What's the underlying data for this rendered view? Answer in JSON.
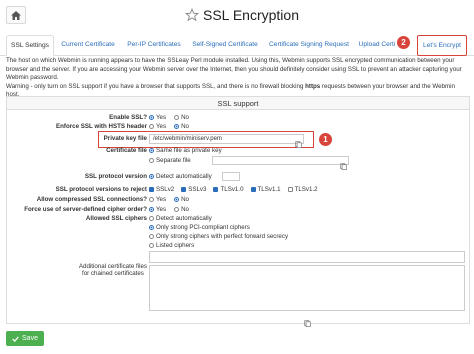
{
  "header": {
    "title": "SSL Encryption",
    "home_icon": "home-icon",
    "star_icon": "star-icon"
  },
  "tabs": [
    {
      "label": "SSL Settings",
      "active": true
    },
    {
      "label": "Current Certificate"
    },
    {
      "label": "Per-IP Certificates"
    },
    {
      "label": "Self-Signed Certificate"
    },
    {
      "label": "Certificate Signing Request"
    },
    {
      "label": "Upload Certi"
    },
    {
      "label": "Let's Encrypt",
      "highlighted": true
    }
  ],
  "annotations": {
    "badge1": "1",
    "badge2": "2",
    "accent": "#d9443a"
  },
  "intro": {
    "line1": "The host on which Webmin is running appears to have the SSLeay Perl module installed. Using this, Webmin supports SSL encrypted communication between your",
    "line2": "browser and the server. If you are accessing your Webmin server over the Internet, then you should definitely consider using SSL to prevent an attacker capturing your",
    "line3": "Webmin password.",
    "line4a": "Warning - only turn on SSL support if you have a browser that supports SSL, and there is no firewall blocking ",
    "line4b": "https",
    "line4c": " requests between your browser and the Webmin host."
  },
  "panel": {
    "title": "SSL support",
    "enable_ssl": {
      "label": "Enable SSL?",
      "yes": "Yes",
      "no": "No"
    },
    "hsts": {
      "label": "Enforce SSL with HSTS header",
      "yes": "Yes",
      "no": "No"
    },
    "private_key": {
      "label": "Private key file",
      "value": "/etc/webmin/miniserv.pem"
    },
    "cert_file": {
      "label": "Certificate file",
      "same": "Same file as private key",
      "separate": "Separate file"
    },
    "ssl_version": {
      "label": "SSL protocol version",
      "value": "Detect automatically"
    },
    "reject": {
      "label": "SSL protocol versions to reject",
      "options": [
        "SSLv2",
        "SSLv3",
        "TLSv1.0",
        "TLSv1.1",
        "TLSv1.2"
      ]
    },
    "compressed": {
      "label": "Allow compressed SSL connections?",
      "yes": "Yes",
      "no": "No"
    },
    "server_order": {
      "label": "Force use of server-defined cipher order?",
      "yes": "Yes",
      "no": "No"
    },
    "ciphers": {
      "label": "Allowed SSL ciphers",
      "options": [
        "Detect automatically",
        "Only strong PCI-compliant ciphers",
        "Only strong ciphers with perfect forward secrecy",
        "Listed ciphers"
      ]
    },
    "chained": {
      "label_line1": "Additional certificate files",
      "label_line2": "for chained certificates"
    }
  },
  "footer": {
    "save_label": "Save"
  }
}
